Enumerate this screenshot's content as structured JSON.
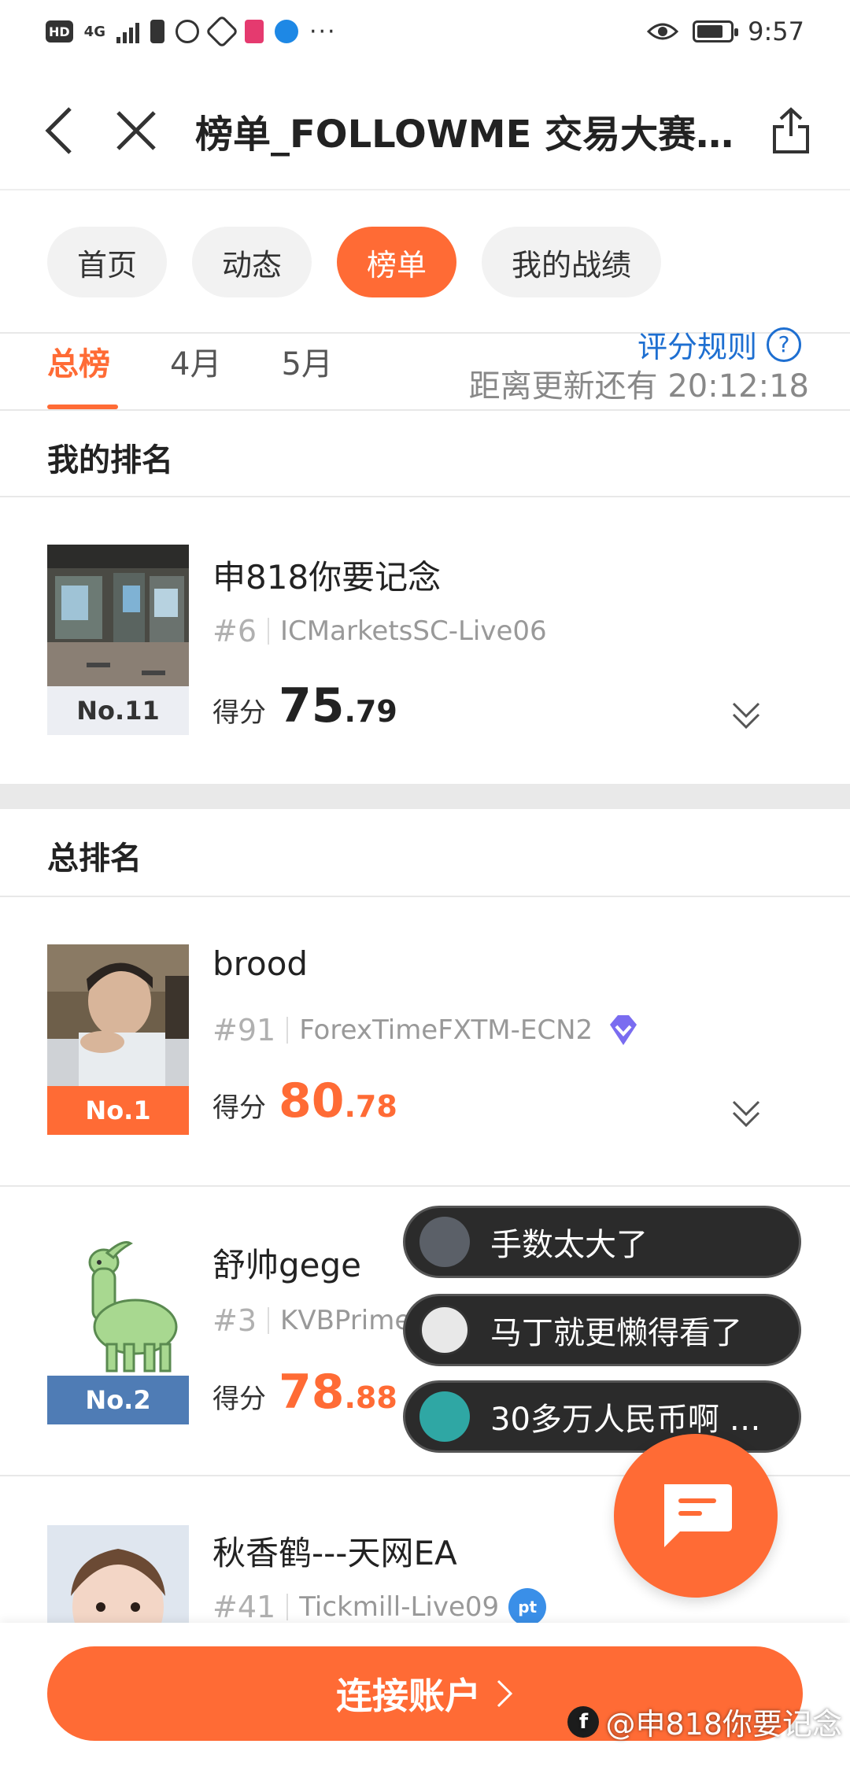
{
  "status_bar": {
    "hd": "HD",
    "net": "4G",
    "time": "9:57",
    "battery_level": 0.8
  },
  "title_bar": {
    "title": "榜单_FOLLOWME 交易大赛…",
    "icons": [
      "back-icon",
      "close-icon",
      "share-icon"
    ]
  },
  "pills": [
    {
      "label": "首页",
      "active": false
    },
    {
      "label": "动态",
      "active": false
    },
    {
      "label": "榜单",
      "active": true
    },
    {
      "label": "我的战绩",
      "active": false
    }
  ],
  "subtabs": [
    {
      "label": "总榜",
      "active": true
    },
    {
      "label": "4月",
      "active": false
    },
    {
      "label": "5月",
      "active": false
    }
  ],
  "rules_link": "评分规则",
  "countdown": "距离更新还有 20:12:18",
  "my_ranking": {
    "section_title": "我的排名",
    "entry": {
      "name": "申818你要记念",
      "rank_label": "No.11",
      "position": "#6",
      "server": "ICMarketsSC-Live06",
      "score_label": "得分",
      "score_int": "75",
      "score_dec": ".79"
    }
  },
  "overall_ranking": {
    "section_title": "总排名",
    "entries": [
      {
        "name": "brood",
        "rank_label": "No.1",
        "position": "#91",
        "server": "ForexTimeFXTM-ECN2",
        "score_label": "得分",
        "score_int": "80",
        "score_dec": ".78",
        "badge": "diamond-badge-icon"
      },
      {
        "name": "舒帅gege",
        "rank_label": "No.2",
        "position": "#3",
        "server": "KVBPrime",
        "score_label": "得分",
        "score_int": "78",
        "score_dec": ".88"
      },
      {
        "name": "秋香鹤---天网EA",
        "position": "#41",
        "server": "Tickmill-Live09",
        "badge": "pt"
      }
    ]
  },
  "danmaku": [
    {
      "text": "手数太大了"
    },
    {
      "text": "马丁就更懒得看了"
    },
    {
      "text": "30多万人民币啊 …"
    }
  ],
  "connect_button": {
    "label": "连接账户"
  },
  "watermark": {
    "logo": "f",
    "text": "@申818你要记念"
  },
  "colors": {
    "accent": "#ff6b35",
    "link": "#1e6fd1",
    "rank2": "#4f7cb5"
  }
}
